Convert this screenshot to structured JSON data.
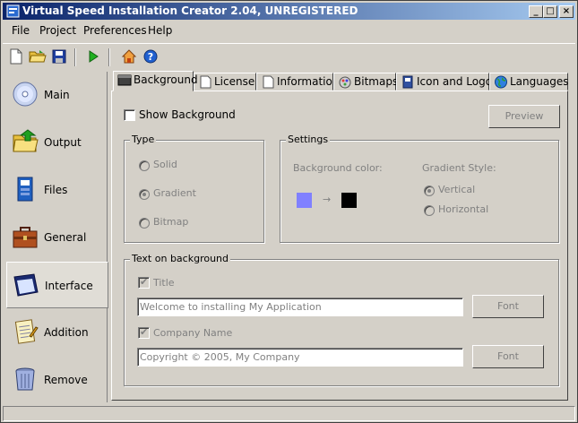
{
  "window": {
    "title": "Virtual Speed Installation Creator 2.04, UNREGISTERED"
  },
  "caption_buttons": {
    "minimize": "_",
    "maximize": "□",
    "close": "×"
  },
  "menu": [
    "File",
    "Project",
    "Preferences",
    "Help"
  ],
  "toolbar": {
    "icons": [
      "new-file-icon",
      "open-folder-icon",
      "save-icon",
      "run-icon",
      "home-icon",
      "help-icon"
    ]
  },
  "sidebar": {
    "items": [
      {
        "label": "Main",
        "icon": "cd-icon"
      },
      {
        "label": "Output",
        "icon": "output-folder-icon"
      },
      {
        "label": "Files",
        "icon": "files-icon"
      },
      {
        "label": "General",
        "icon": "briefcase-icon"
      },
      {
        "label": "Interface",
        "icon": "interface-window-icon",
        "active": true
      },
      {
        "label": "Addition",
        "icon": "notepad-icon"
      },
      {
        "label": "Remove",
        "icon": "recycle-bin-icon"
      }
    ]
  },
  "tabs": [
    {
      "label": "Background",
      "active": true
    },
    {
      "label": "License"
    },
    {
      "label": "Information"
    },
    {
      "label": "Bitmaps"
    },
    {
      "label": "Icon and Logo"
    },
    {
      "label": "Languages"
    }
  ],
  "background": {
    "show_background_label": "Show Background",
    "show_background_checked": false,
    "preview_button": "Preview",
    "type_group": {
      "title": "Type",
      "options": [
        "Solid",
        "Gradient",
        "Bitmap"
      ],
      "selected": "Gradient"
    },
    "settings_group": {
      "title": "Settings",
      "bg_color_label": "Background color:",
      "arrow": "→",
      "color_from": "#8080ff",
      "color_to": "#000000",
      "gradient_style_label": "Gradient Style:",
      "options": [
        "Vertical",
        "Horizontal"
      ],
      "selected": "Vertical"
    },
    "text_group": {
      "title": "Text on background",
      "title_label": "Title",
      "title_checked": true,
      "title_value": "Welcome to installing My Application",
      "company_label": "Company Name",
      "company_checked": true,
      "company_value": "Copyright © 2005, My Company",
      "font_button": "Font"
    }
  }
}
